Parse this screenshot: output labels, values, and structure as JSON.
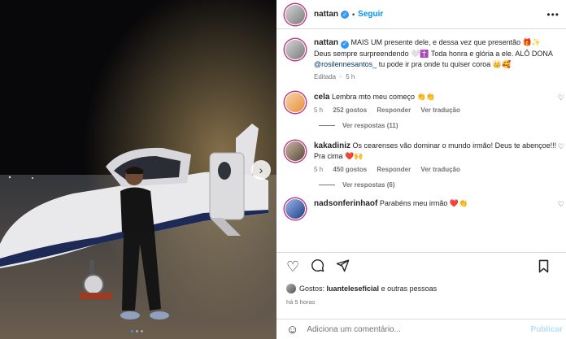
{
  "post": {
    "author": "nattan",
    "follow_label": "Seguir",
    "more_label": "•••",
    "verified_glyph": "✓"
  },
  "caption": {
    "author": "nattan",
    "text_before": "MAIS UM presente dele, e dessa vez que presentão 🎁✨ Deus sempre surpreendendo 🤍✝️ Toda honra e glória a ele. ALÔ DONA ",
    "mention": "@rosilennesantos_",
    "text_after": " tu pode ir pra onde tu quiser coroa 👑🥰",
    "edited": "Editada",
    "time": "5 h"
  },
  "comments": [
    {
      "author": "cela",
      "text": "Lembra mto meu começo 👏👏",
      "time": "5 h",
      "likes": "252 gostos",
      "reply_label": "Responder",
      "translate_label": "Ver tradução",
      "view_replies": "Ver respostas (11)"
    },
    {
      "author": "kakadiniz",
      "text": "Os cearenses vão dominar o mundo irmão! Deus te abençoe!!! Pra cima ❤️🙌",
      "time": "5 h",
      "likes": "450 gostos",
      "reply_label": "Responder",
      "translate_label": "Ver tradução",
      "view_replies": "Ver respostas (6)"
    },
    {
      "author": "nadsonferinhaof",
      "text": "Parabéns meu irmão ❤️👏"
    }
  ],
  "actions": {
    "like_icon": "heart-icon",
    "comment_icon": "comment-icon",
    "share_icon": "share-icon",
    "save_icon": "bookmark-icon"
  },
  "likes_line": {
    "prefix": "Gostos:",
    "user": "luanteleseficial",
    "suffix": "e outras pessoas"
  },
  "timestamp": "há 5 horas",
  "add_comment": {
    "placeholder": "Adiciona um comentário...",
    "publish": "Publicar"
  },
  "carousel": {
    "next_glyph": "›",
    "current_slide": 1,
    "total_slides": 3
  },
  "colors": {
    "accent": "#0095f6",
    "verified": "#3897f0",
    "heart": "#ed4956"
  }
}
